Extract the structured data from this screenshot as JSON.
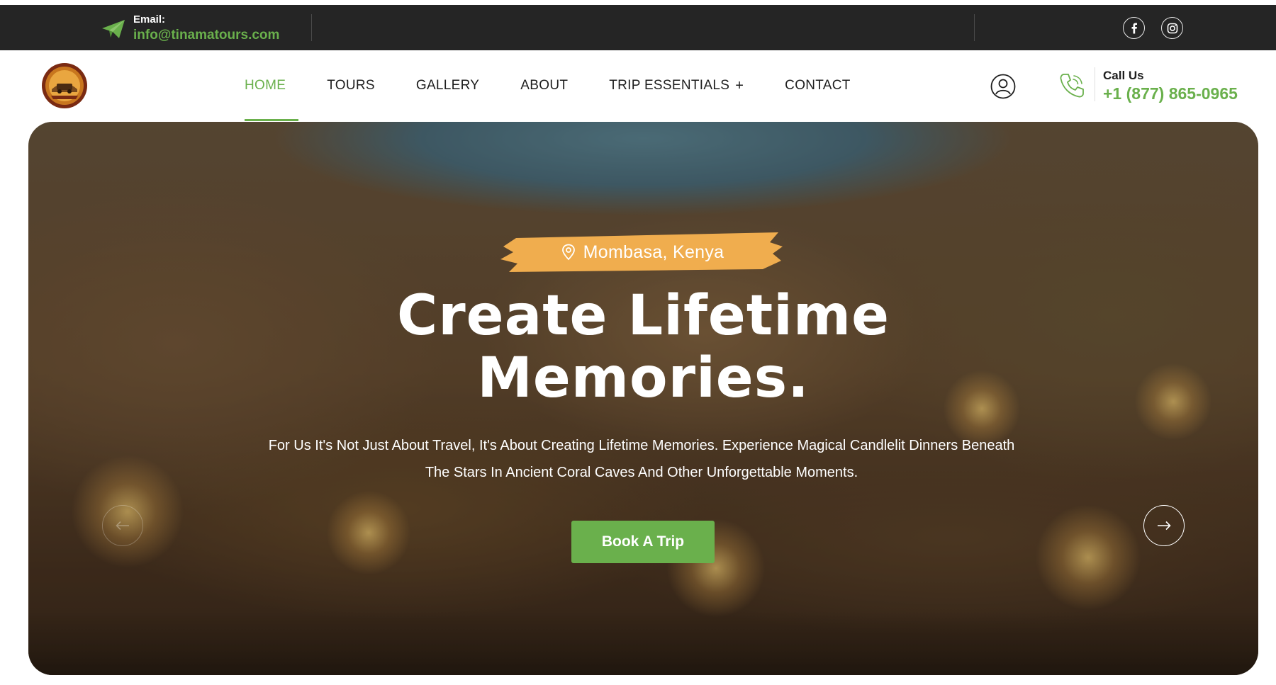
{
  "topbar": {
    "email_label": "Email:",
    "email_value": "info@tinamatours.com",
    "icons": [
      "paper-plane-icon",
      "facebook-icon",
      "instagram-icon"
    ]
  },
  "nav": {
    "items": [
      {
        "label": "HOME",
        "active": true
      },
      {
        "label": "TOURS"
      },
      {
        "label": "GALLERY"
      },
      {
        "label": "ABOUT"
      },
      {
        "label": "TRIP ESSENTIALS",
        "suffix": "+"
      },
      {
        "label": "CONTACT"
      }
    ]
  },
  "contact": {
    "call_label": "Call Us",
    "phone": "+1 (877) 865-0965"
  },
  "hero": {
    "location": "Mombasa, Kenya",
    "title_line1": "Create Lifetime",
    "title_line2": "Memories.",
    "desc_line1": "For Us It's Not Just About Travel, It's About Creating Lifetime Memories. Experience Magical Candlelit Dinners Beneath",
    "desc_line2": "The Stars In Ancient Coral Caves And Other Unforgettable Moments.",
    "cta": "Book A Trip"
  },
  "colors": {
    "accent": "#6ab04c",
    "topbar_bg": "#252525",
    "badge": "#f0ad4e"
  }
}
